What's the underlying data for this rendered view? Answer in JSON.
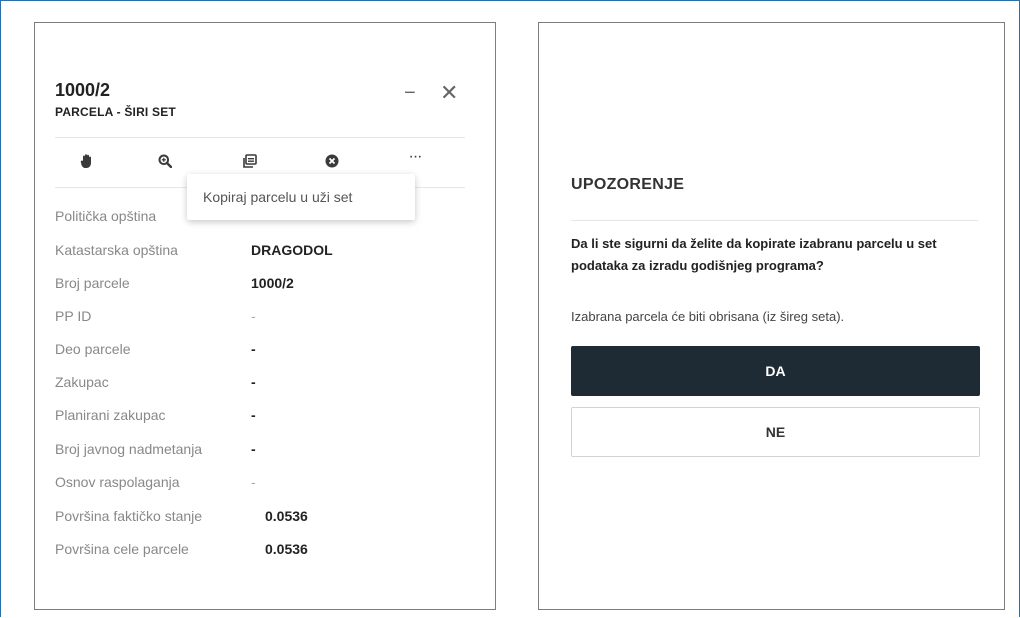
{
  "parcel": {
    "title": "1000/2",
    "subtitle": "PARCELA - ŠIRI SET",
    "minimize_label": "−",
    "close_label": "✕",
    "toolbar": [
      {
        "icon": "hand-icon"
      },
      {
        "icon": "zoom-in-icon"
      },
      {
        "icon": "copy-icon"
      },
      {
        "icon": "remove-circle-icon"
      },
      {
        "icon": "more-icon",
        "label": "···"
      }
    ],
    "tooltip": "Kopiraj parcelu u uži set",
    "fields": [
      {
        "label": "Politička opština",
        "value": ""
      },
      {
        "label": "Katastarska opština",
        "value": "DRAGODOL"
      },
      {
        "label": "Broj parcele",
        "value": "1000/2"
      },
      {
        "label": "PP ID",
        "value": "-"
      },
      {
        "label": "Deo parcele",
        "value": "-"
      },
      {
        "label": "Zakupac",
        "value": "-"
      },
      {
        "label": "Planirani zakupac",
        "value": "-"
      },
      {
        "label": "Broj javnog nadmetanja",
        "value": "-"
      },
      {
        "label": "Osnov raspolaganja",
        "value": "-"
      },
      {
        "label": "Površina faktičko stanje",
        "value": "0.0536"
      },
      {
        "label": "Površina cele parcele",
        "value": "0.0536"
      }
    ]
  },
  "dialog": {
    "title": "UPOZORENJE",
    "question": "Da li ste sigurni da želite da kopirate izabranu parcelu u set podataka za izradu godišnjeg programa?",
    "note": "Izabrana parcela će biti obrisana (iz šireg seta).",
    "confirm_label": "DA",
    "cancel_label": "NE"
  },
  "colors": {
    "frame": "#2b6fa8",
    "confirm_bg": "#1e2b34",
    "icon": "#3a3a3a"
  }
}
